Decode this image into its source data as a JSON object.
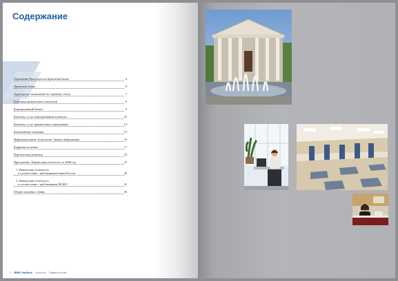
{
  "left_page": {
    "title": "Содержание",
    "toc": [
      {
        "text": "Обращение Председателя Правления Банка",
        "page": "4"
      },
      {
        "text": "Правление Банка",
        "page": "6"
      },
      {
        "text": "Аудиторское заключение по годовому отчету",
        "page": "7"
      },
      {
        "text": "Основные финансовые показатели",
        "page": "8"
      },
      {
        "text": "Корпоративный бизнес",
        "page": "9"
      },
      {
        "text": "Комплекс услуг корпоративным клиентам",
        "page": "10"
      },
      {
        "text": "Комплекс услуг финансовым учреждениям",
        "page": "14"
      },
      {
        "text": "Казначейские операции",
        "page": "15"
      },
      {
        "text": "Информационные технологии. Защита информации",
        "page": "16"
      },
      {
        "text": "Кадровая политика",
        "page": "17"
      },
      {
        "text": "Перспективы развития",
        "page": "18"
      },
      {
        "text": "Приложение. Финансовая отчетность за 2008 год",
        "page": "19"
      }
    ],
    "toc_sub": [
      {
        "line1": "1. Финансовая отчетность",
        "line2": "в соответствии с требованиями Банка России",
        "page": "20"
      },
      {
        "line1": "2. Финансовая отчетность",
        "line2": "в соответствии с требованиями МСФО",
        "page": "32"
      }
    ],
    "toc_last": {
      "text": "Общие сведения о Банке",
      "page": "56"
    },
    "footer": {
      "page_number": "2",
      "bank": "ВМБ-Гарбанк",
      "report": "Годовой отчет"
    }
  },
  "colors": {
    "accent": "#1d5fa8",
    "background": "#8f9094"
  },
  "photos": [
    {
      "name": "building-photo",
      "subject": "columned building with fountain"
    },
    {
      "name": "office-worker-photo",
      "subject": "man at computer by window"
    },
    {
      "name": "bank-hall-photo",
      "subject": "bank interior hall with tiled floor"
    },
    {
      "name": "clerk-photo",
      "subject": "woman at service desk"
    }
  ]
}
